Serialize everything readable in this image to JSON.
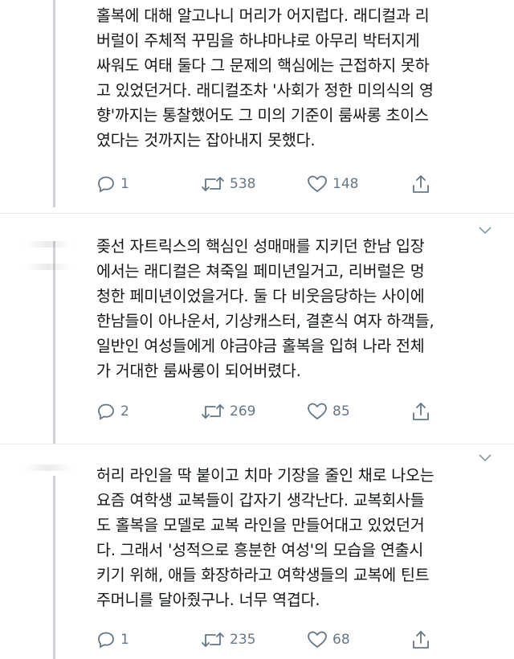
{
  "tweets": [
    {
      "text": "홀복에 대해 알고나니 머리가 어지럽다. 래디컬과 리\n버럴이 주체적 꾸밈을 하냐마냐로 아무리 박터지게\n싸워도 여태 둘다 그 문제의 핵심에는 근접하지 못하\n고 있었던거다. 래디컬조차 '사회가 정한 미의식의 영\n향'까지는 통찰했어도 그 미의 기준이 룸싸롱 초이스\n였다는 것까지는 잡아내지 못했다.",
      "replies": "1",
      "retweets": "538",
      "likes": "148"
    },
    {
      "text": "좆선 자트릭스의 핵심인 성매매를 지키던 한남 입장\n에서는 래디컬은 쳐죽일 페미년일거고, 리버럴은 멍\n청한 페미년이었을거다. 둘 다 비웃음당하는 사이에\n한남들이 아나운서, 기상캐스터, 결혼식 여자 하객들,\n일반인 여성들에게 야금야금 홀복을 입혀 나라 전체\n가 거대한 룸싸롱이 되어버렸다.",
      "replies": "2",
      "retweets": "269",
      "likes": "85"
    },
    {
      "text": "허리 라인을 딱 붙이고 치마 기장을 줄인 채로 나오는\n요즘 여학생 교복들이 갑자기 생각난다. 교복회사들\n도 홀복을 모델로 교복 라인을 만들어대고 있었던거\n다. 그래서 '성적으로 흥분한 여성'의 모습을 연출시\n키기 위해, 애들 화장하라고 여학생들의 교복에 틴트\n주머니를 달아줬구나. 너무 역겹다.",
      "replies": "1",
      "retweets": "235",
      "likes": "68"
    }
  ],
  "icons": {
    "reply": "reply-icon",
    "retweet": "retweet-icon",
    "like": "heart-icon",
    "share": "share-icon",
    "more": "chevron-down-icon"
  },
  "colors": {
    "text": "#14171a",
    "meta": "#657786",
    "thread_line": "#d0d4d8"
  }
}
